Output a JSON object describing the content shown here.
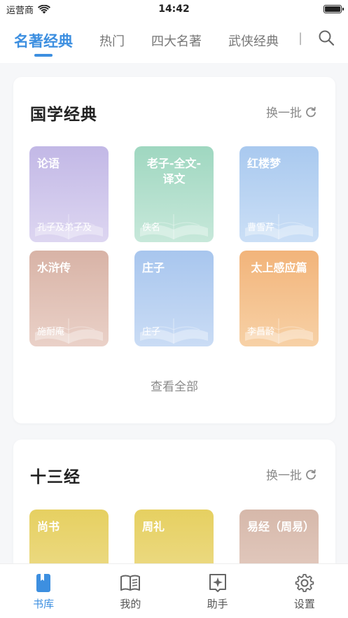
{
  "status_bar": {
    "carrier": "运营商",
    "time": "14:42"
  },
  "tabs": [
    {
      "label": "名著经典",
      "active": true
    },
    {
      "label": "热门",
      "active": false
    },
    {
      "label": "四大名著",
      "active": false
    },
    {
      "label": "武侠经典",
      "active": false
    }
  ],
  "sections": [
    {
      "title": "国学经典",
      "refresh_label": "换一批",
      "view_all_label": "查看全部",
      "books": [
        {
          "title": "论语",
          "author": "孔子及弟子及",
          "color_top": "#c2b8e6",
          "color_bottom": "#ddd6f1"
        },
        {
          "title": "老子-全文-译文",
          "author": "佚名",
          "color_top": "#9fd7c0",
          "color_bottom": "#c7e8da"
        },
        {
          "title": "红楼梦",
          "author": "曹雪芹",
          "color_top": "#a9c9ef",
          "color_bottom": "#cbdff6"
        },
        {
          "title": "水浒传",
          "author": "施耐庵",
          "color_top": "#d8b3a6",
          "color_bottom": "#ead1c8"
        },
        {
          "title": "庄子",
          "author": "庄子",
          "color_top": "#a8c6ee",
          "color_bottom": "#cadcf5"
        },
        {
          "title": "太上感应篇",
          "author": "李昌龄",
          "color_top": "#f2b47a",
          "color_bottom": "#f7d1a6"
        }
      ]
    },
    {
      "title": "十三经",
      "refresh_label": "换一批",
      "books": [
        {
          "title": "尚书",
          "color_top": "#e6d061",
          "color_bottom": "#efdf95"
        },
        {
          "title": "周礼",
          "color_top": "#e6d061",
          "color_bottom": "#efdf95"
        },
        {
          "title": "易经（周易）",
          "color_top": "#d6b8aa",
          "color_bottom": "#e8d2c8"
        }
      ]
    }
  ],
  "bottom_nav": [
    {
      "label": "书库",
      "icon": "bookmark-book-icon",
      "active": true
    },
    {
      "label": "我的",
      "icon": "open-book-icon",
      "active": false
    },
    {
      "label": "助手",
      "icon": "sparkle-icon",
      "active": false
    },
    {
      "label": "设置",
      "icon": "gear-icon",
      "active": false
    }
  ],
  "colors": {
    "accent": "#3d8fe0",
    "muted": "#8a8a8a",
    "background": "#f6f7f9"
  }
}
